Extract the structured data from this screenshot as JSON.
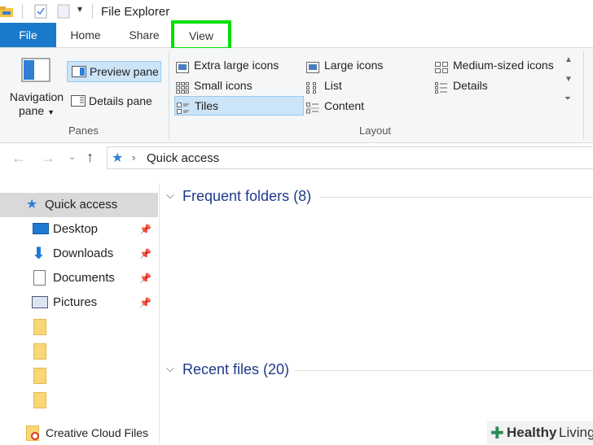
{
  "window": {
    "title": "File Explorer"
  },
  "tabs": [
    {
      "label": "File"
    },
    {
      "label": "Home"
    },
    {
      "label": "Share"
    },
    {
      "label": "View"
    }
  ],
  "ribbon": {
    "panes": {
      "navigation_pane_line1": "Navigation",
      "navigation_pane_line2": "pane",
      "preview_pane": "Preview pane",
      "details_pane": "Details pane",
      "group_label": "Panes"
    },
    "layout": {
      "items": [
        {
          "label": "Extra large icons"
        },
        {
          "label": "Large icons"
        },
        {
          "label": "Medium-sized icons"
        },
        {
          "label": "Small icons"
        },
        {
          "label": "List"
        },
        {
          "label": "Details"
        },
        {
          "label": "Tiles"
        },
        {
          "label": "Content"
        }
      ],
      "group_label": "Layout"
    }
  },
  "address": {
    "path": "Quick access"
  },
  "nav": {
    "items": [
      {
        "label": "Quick access"
      },
      {
        "label": "Desktop"
      },
      {
        "label": "Downloads"
      },
      {
        "label": "Documents"
      },
      {
        "label": "Pictures"
      },
      {
        "label": "Creative Cloud Files"
      }
    ]
  },
  "content": {
    "frequent": "Frequent folders (8)",
    "recent": "Recent files (20)"
  },
  "watermark": {
    "brand": "Healthy",
    "brand2": "Living"
  }
}
